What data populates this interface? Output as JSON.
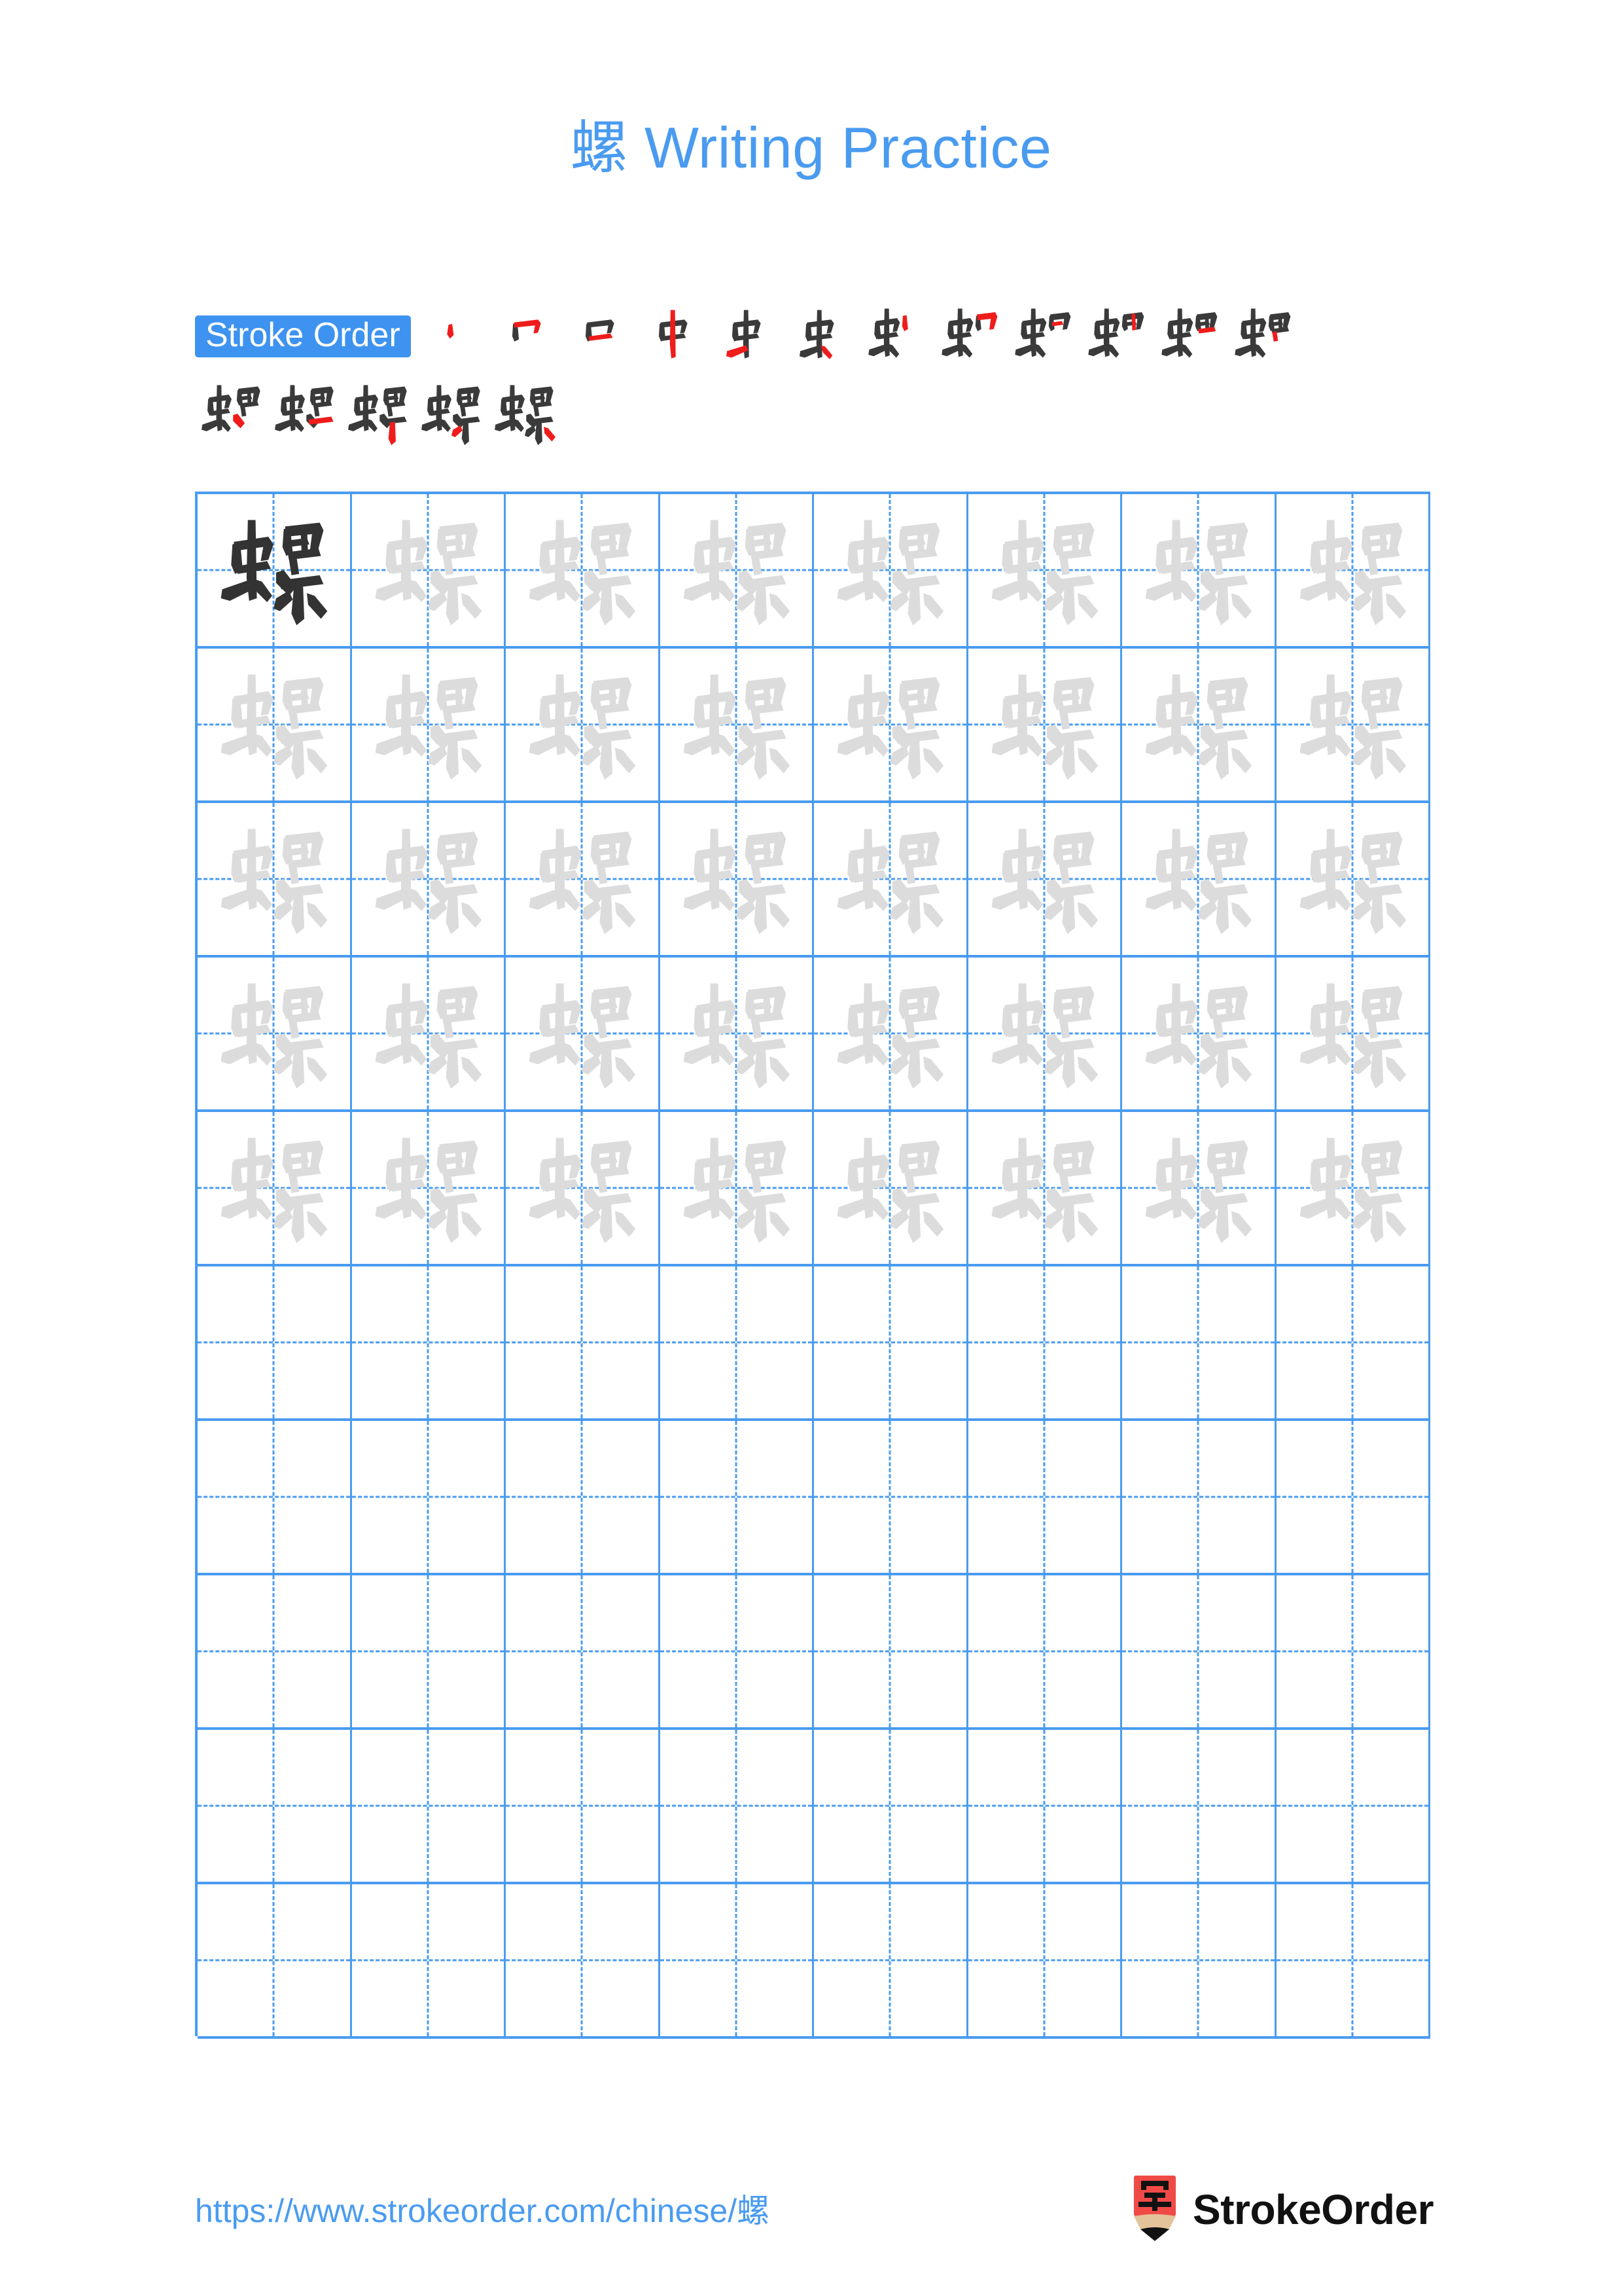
{
  "page": {
    "character": "螺",
    "title_suffix": " Writing Practice",
    "title_full": "螺 Writing Practice"
  },
  "colors": {
    "accent_blue": "#4a9bf0",
    "badge_blue": "#3d93ef",
    "stroke_new_red": "#ef1c1c",
    "stroke_done_dark": "#3a3a3a",
    "trace_gray": "#dcdcdc",
    "model_dark": "#333333",
    "logo_red": "#f04a47",
    "logo_wood": "#e3c49a"
  },
  "stroke_order": {
    "badge_label": "Stroke Order",
    "total_strokes": 17,
    "steps": [
      {
        "index": 1,
        "char": "丶"
      },
      {
        "index": 2,
        "char": "冂"
      },
      {
        "index": 3,
        "char": "口"
      },
      {
        "index": 4,
        "char": "中"
      },
      {
        "index": 5,
        "char": "虫"
      },
      {
        "index": 6,
        "char": "虫"
      },
      {
        "index": 7,
        "char": "虫"
      },
      {
        "index": 8,
        "char": "虫"
      },
      {
        "index": 9,
        "char": "虫"
      },
      {
        "index": 10,
        "char": "虫"
      },
      {
        "index": 11,
        "char": "螺"
      },
      {
        "index": 12,
        "char": "螺"
      },
      {
        "index": 13,
        "char": "螺"
      },
      {
        "index": 14,
        "char": "螺"
      },
      {
        "index": 15,
        "char": "螺"
      },
      {
        "index": 16,
        "char": "螺"
      },
      {
        "index": 17,
        "char": "螺"
      }
    ],
    "row_counts": [
      12,
      5
    ]
  },
  "practice_grid": {
    "columns": 8,
    "rows": 10,
    "filled_rows": 5,
    "empty_rows": 5,
    "model_cell": {
      "row": 1,
      "column": 1,
      "char": "螺",
      "style": "dark"
    },
    "trace_char": "螺"
  },
  "footer": {
    "url_text": "https://www.strokeorder.com/chinese/螺",
    "brand_name": "StrokeOrder",
    "logo_char": "字",
    "logo_icon": "pencil-icon"
  }
}
